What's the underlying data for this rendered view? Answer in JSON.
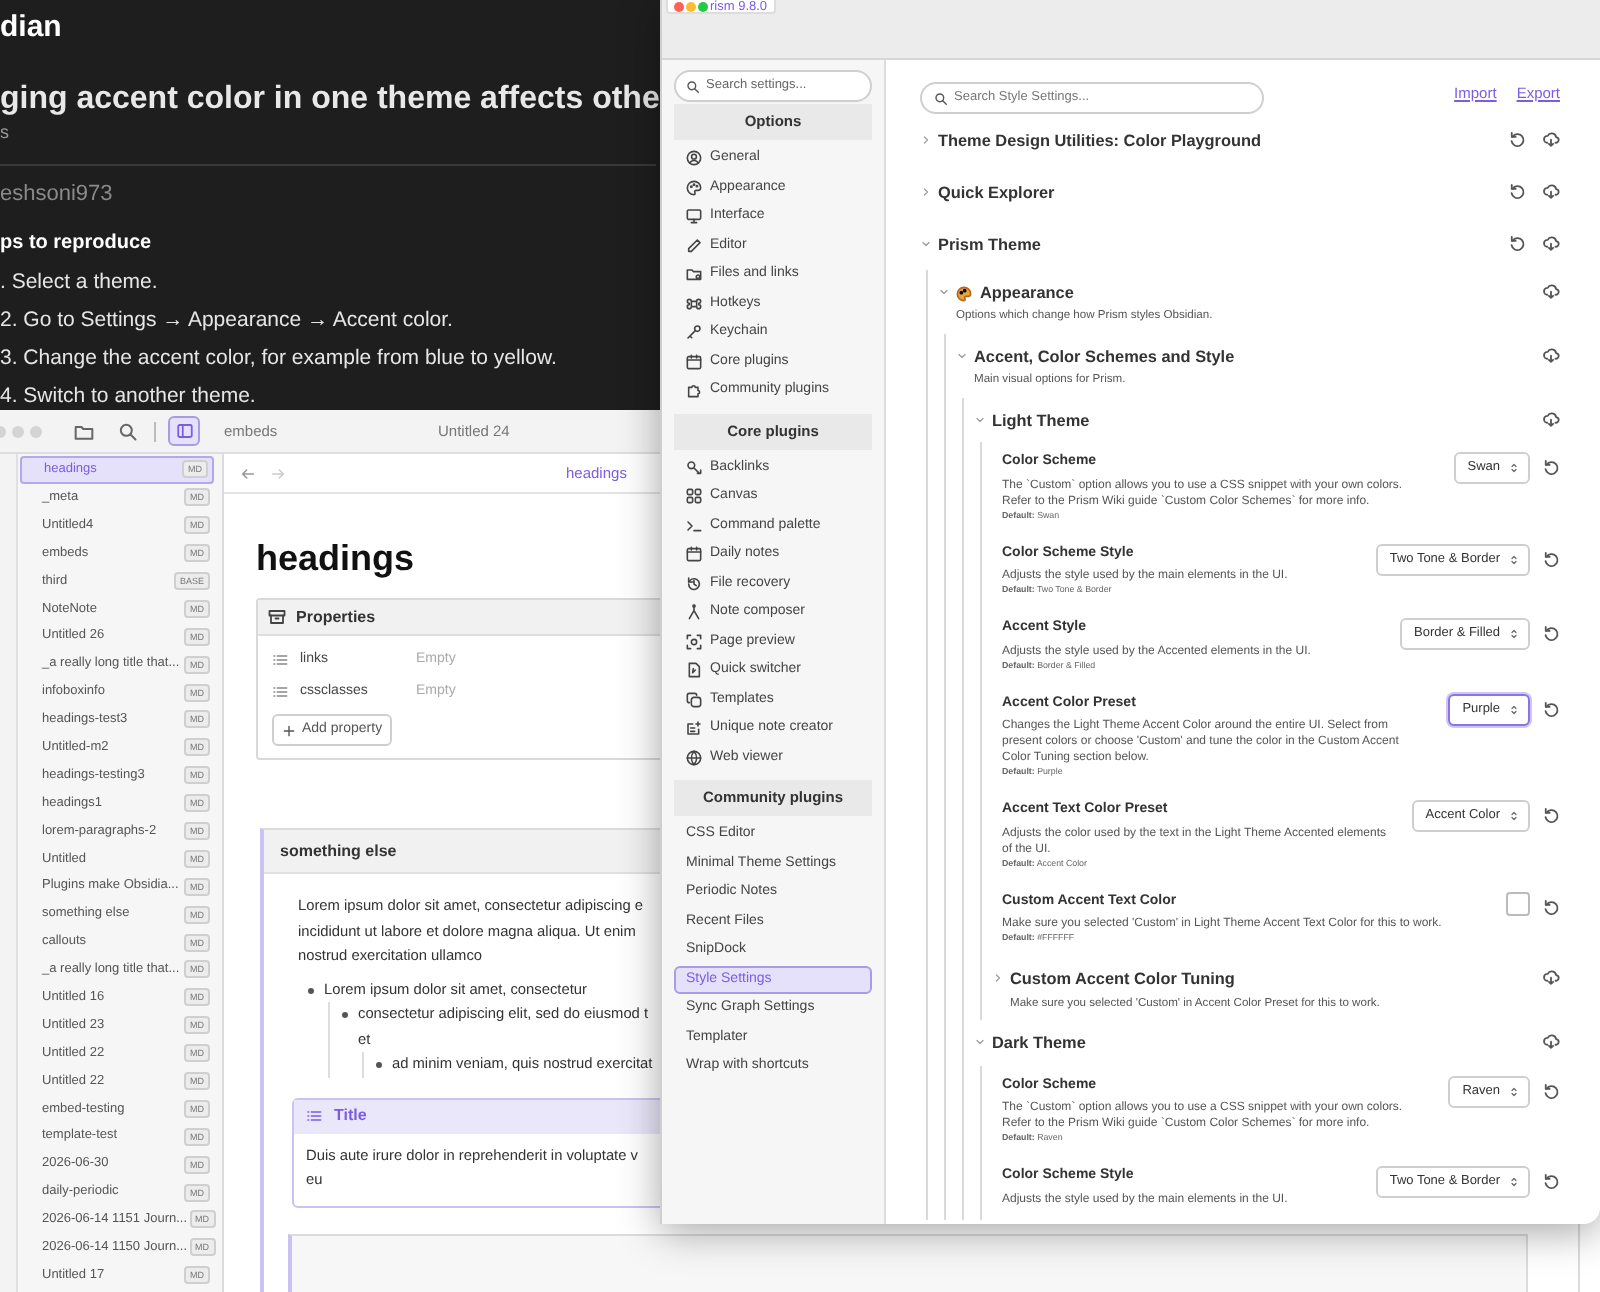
{
  "web_page": {
    "site_title": "dian",
    "issue_title": "ging accent color in one theme affects othe",
    "subtitle": "s",
    "author": "eshsoni973",
    "section_heading": "ps to reproduce",
    "steps": [
      ". Select a theme.",
      "2. Go to Settings → Appearance → Accent color.",
      "3. Change the accent color, for example from blue to yellow.",
      "4. Switch to another theme."
    ]
  },
  "obsidian": {
    "tabs": [
      {
        "label": "embeds",
        "selected": false
      },
      {
        "label": "Untitled 24",
        "selected": false
      }
    ],
    "files": [
      {
        "name": "headings",
        "badge": "MD",
        "selected": true
      },
      {
        "name": "_meta",
        "badge": "MD",
        "selected": false
      },
      {
        "name": "Untitled4",
        "badge": "MD",
        "selected": false
      },
      {
        "name": "embeds",
        "badge": "MD",
        "selected": false
      },
      {
        "name": "third",
        "badge": "BASE",
        "selected": false
      },
      {
        "name": "NoteNote",
        "badge": "MD",
        "selected": false
      },
      {
        "name": "Untitled 26",
        "badge": "MD",
        "selected": false
      },
      {
        "name": "_a really long title that...",
        "badge": "MD",
        "selected": false
      },
      {
        "name": "infoboxinfo",
        "badge": "MD",
        "selected": false
      },
      {
        "name": "headings-test3",
        "badge": "MD",
        "selected": false
      },
      {
        "name": "Untitled-m2",
        "badge": "MD",
        "selected": false
      },
      {
        "name": "headings-testing3",
        "badge": "MD",
        "selected": false
      },
      {
        "name": "headings1",
        "badge": "MD",
        "selected": false
      },
      {
        "name": "lorem-paragraphs-2",
        "badge": "MD",
        "selected": false
      },
      {
        "name": "Untitled",
        "badge": "MD",
        "selected": false
      },
      {
        "name": "Plugins make Obsidia...",
        "badge": "MD",
        "selected": false
      },
      {
        "name": "something else",
        "badge": "MD",
        "selected": false
      },
      {
        "name": "callouts",
        "badge": "MD",
        "selected": false
      },
      {
        "name": "_a really long title that...",
        "badge": "MD",
        "selected": false
      },
      {
        "name": "Untitled 16",
        "badge": "MD",
        "selected": false
      },
      {
        "name": "Untitled 23",
        "badge": "MD",
        "selected": false
      },
      {
        "name": "Untitled 22",
        "badge": "MD",
        "selected": false
      },
      {
        "name": "Untitled 22",
        "badge": "MD",
        "selected": false
      },
      {
        "name": "embed-testing",
        "badge": "MD",
        "selected": false
      },
      {
        "name": "template-test",
        "badge": "MD",
        "selected": false
      },
      {
        "name": "2026-06-30",
        "badge": "MD",
        "selected": false
      },
      {
        "name": "daily-periodic",
        "badge": "MD",
        "selected": false
      },
      {
        "name": "2026-06-14 1151 Journ...",
        "badge": "MD",
        "selected": false
      },
      {
        "name": "2026-06-14 1150 Journ...",
        "badge": "MD",
        "selected": false
      },
      {
        "name": "Untitled 17",
        "badge": "MD",
        "selected": false
      }
    ],
    "editor": {
      "view_title": "headings",
      "heading": "headings",
      "properties": {
        "title": "Properties",
        "items": [
          {
            "name": "links",
            "value": "Empty"
          },
          {
            "name": "cssclasses",
            "value": "Empty"
          }
        ],
        "add_button": "Add property"
      },
      "embed": {
        "title": "something else",
        "paragraph_lines": [
          "Lorem ipsum dolor sit amet, consectetur adipiscing e",
          "incididunt ut labore et dolore magna aliqua. Ut enim",
          "nostrud exercitation ullamco"
        ],
        "bullets": [
          {
            "text": "Lorem ipsum dolor sit amet, consectetur",
            "children": [
              {
                "text": "consectetur adipiscing elit, sed do eiusmod t",
                "continuation": "et",
                "children": [
                  {
                    "text": "ad minim veniam, quis nostrud exercitat"
                  }
                ]
              }
            ]
          }
        ],
        "callout": {
          "title": "Title",
          "body_lines": [
            "Duis aute irure dolor in reprehenderit in voluptate v",
            "eu"
          ]
        }
      }
    }
  },
  "settings": {
    "version_badge": "rism 9.8.0",
    "search_placeholder": "Search settings...",
    "sections": [
      {
        "title": "Options",
        "items": [
          {
            "label": "General",
            "selected": false
          },
          {
            "label": "Appearance",
            "selected": false
          },
          {
            "label": "Interface",
            "selected": false
          },
          {
            "label": "Editor",
            "selected": false
          },
          {
            "label": "Files and links",
            "selected": false
          },
          {
            "label": "Hotkeys",
            "selected": false
          },
          {
            "label": "Keychain",
            "selected": false
          },
          {
            "label": "Core plugins",
            "selected": false
          },
          {
            "label": "Community plugins",
            "selected": false
          }
        ]
      },
      {
        "title": "Core plugins",
        "items": [
          {
            "label": "Backlinks",
            "selected": false
          },
          {
            "label": "Canvas",
            "selected": false
          },
          {
            "label": "Command palette",
            "selected": false
          },
          {
            "label": "Daily notes",
            "selected": false
          },
          {
            "label": "File recovery",
            "selected": false
          },
          {
            "label": "Note composer",
            "selected": false
          },
          {
            "label": "Page preview",
            "selected": false
          },
          {
            "label": "Quick switcher",
            "selected": false
          },
          {
            "label": "Templates",
            "selected": false
          },
          {
            "label": "Unique note creator",
            "selected": false
          },
          {
            "label": "Web viewer",
            "selected": false
          }
        ]
      },
      {
        "title": "Community plugins",
        "items": [
          {
            "label": "CSS Editor",
            "selected": false
          },
          {
            "label": "Minimal Theme Settings",
            "selected": false
          },
          {
            "label": "Periodic Notes",
            "selected": false
          },
          {
            "label": "Recent Files",
            "selected": false
          },
          {
            "label": "SnipDock",
            "selected": false
          },
          {
            "label": "Style Settings",
            "selected": true
          },
          {
            "label": "Sync Graph Settings",
            "selected": false
          },
          {
            "label": "Templater",
            "selected": false
          },
          {
            "label": "Wrap with shortcuts",
            "selected": false
          }
        ]
      }
    ],
    "style_settings": {
      "search_placeholder": "Search Style Settings...",
      "links": [
        "Import",
        "Export"
      ],
      "tree": [
        {
          "title": "Theme Design Utilities: Color Playground",
          "expanded": false
        },
        {
          "title": "Quick Explorer",
          "expanded": false
        },
        {
          "title": "Prism Theme",
          "expanded": true,
          "children": [
            {
              "title": "Appearance",
              "has_icon": true,
              "description": "Options which change how Prism styles Obsidian.",
              "expanded": true,
              "children": [
                {
                  "title": "Accent, Color Schemes and Style",
                  "description": "Main visual options for Prism.",
                  "expanded": true,
                  "children": [
                    {
                      "title": "Light Theme",
                      "expanded": true,
                      "children": [
                        {
                          "kind": "dropdown",
                          "name": "Color Scheme",
                          "description": "The `Custom` option allows you to use a CSS snippet with your own colors. Refer to the Prism Wiki guide `Custom Color Schemes` for more info.",
                          "default_label": "Default:",
                          "default": "Swan",
                          "value": "Swan",
                          "focused": false
                        },
                        {
                          "kind": "dropdown",
                          "name": "Color Scheme Style",
                          "description": "Adjusts the style used by the main elements in the UI.",
                          "default_label": "Default:",
                          "default": "Two Tone & Border",
                          "value": "Two Tone & Border",
                          "focused": false
                        },
                        {
                          "kind": "dropdown",
                          "name": "Accent Style",
                          "description": "Adjusts the style used by the Accented elements in the UI.",
                          "default_label": "Default:",
                          "default": "Border & Filled",
                          "value": "Border & Filled",
                          "focused": false
                        },
                        {
                          "kind": "dropdown",
                          "name": "Accent Color Preset",
                          "description": "Changes the Light Theme Accent Color around the entire UI. Select from present colors or choose 'Custom' and tune the color in the Custom Accent Color Tuning section below.",
                          "default_label": "Default:",
                          "default": "Purple",
                          "value": "Purple",
                          "focused": true
                        },
                        {
                          "kind": "dropdown",
                          "name": "Accent Text Color Preset",
                          "description": "Adjusts the color used by the text in the Light Theme Accented elements of the UI.",
                          "default_label": "Default:",
                          "default": "Accent Color",
                          "value": "Accent Color",
                          "focused": false
                        },
                        {
                          "kind": "color",
                          "name": "Custom Accent Text Color",
                          "description": "Make sure you selected 'Custom' in Light Theme Accent Text Color for this to work.",
                          "default_label": "Default:",
                          "default": "#FFFFFF",
                          "color": "#ffffff"
                        },
                        {
                          "kind": "group",
                          "title": "Custom Accent Color Tuning",
                          "description": "Make sure you selected 'Custom' in Accent Color Preset for this to work.",
                          "expanded": false
                        }
                      ]
                    },
                    {
                      "title": "Dark Theme",
                      "expanded": true,
                      "children": [
                        {
                          "kind": "dropdown",
                          "name": "Color Scheme",
                          "description": "The `Custom` option allows you to use a CSS snippet with your own colors. Refer to the Prism Wiki guide `Custom Color Schemes` for more info.",
                          "default_label": "Default:",
                          "default": "Raven",
                          "value": "Raven",
                          "focused": false
                        },
                        {
                          "kind": "dropdown",
                          "name": "Color Scheme Style",
                          "description": "Adjusts the style used by the main elements in the UI.",
                          "value": "Two Tone & Border",
                          "focused": false
                        }
                      ]
                    }
                  ]
                }
              ]
            }
          ]
        }
      ]
    }
  }
}
